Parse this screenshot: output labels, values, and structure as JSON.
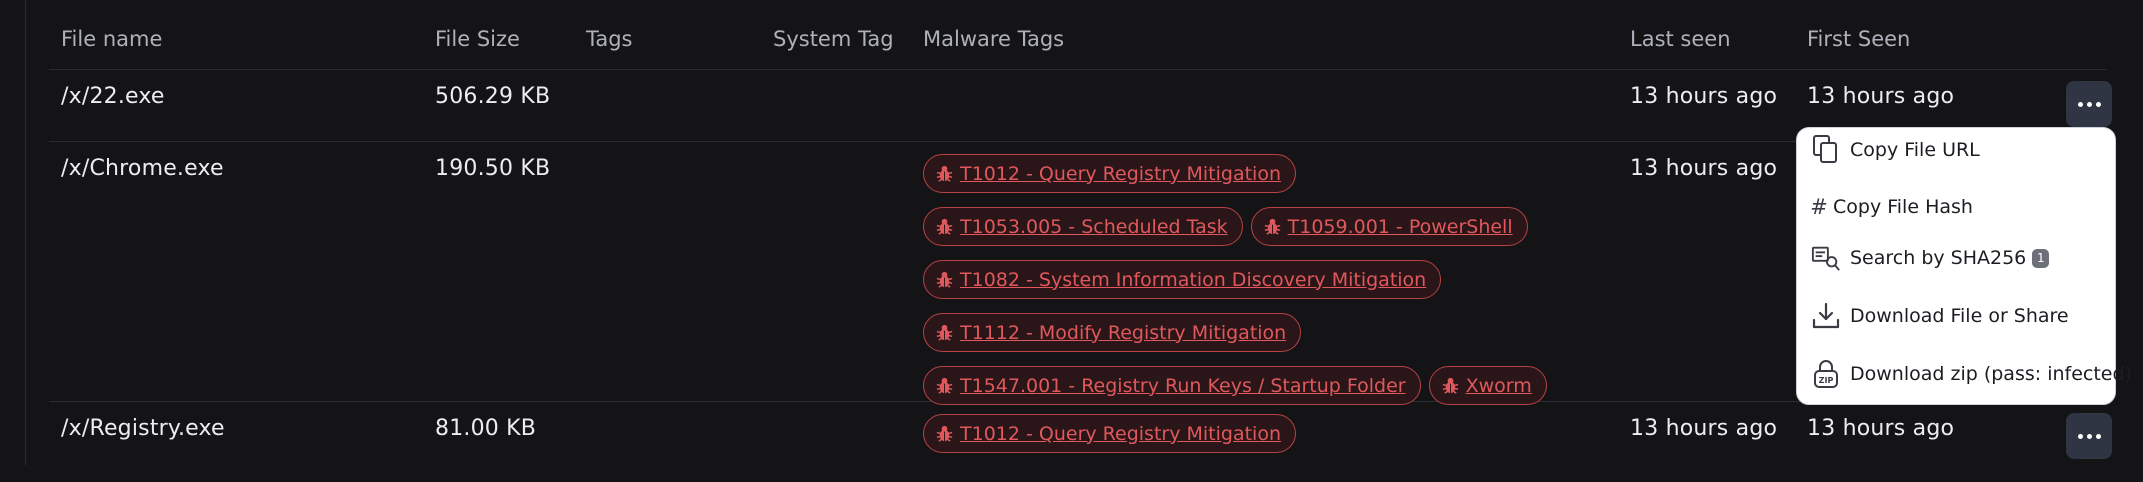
{
  "columns": [
    "File name",
    "File Size",
    "Tags",
    "System Tag",
    "Malware Tags",
    "Last seen",
    "First Seen"
  ],
  "rows": [
    {
      "name": "/x/22.exe",
      "size": "506.29 KB",
      "last_seen": "13 hours ago",
      "first_seen": "13 hours ago",
      "malware_tags": []
    },
    {
      "name": "/x/Chrome.exe",
      "size": "190.50 KB",
      "last_seen": "13 hours ago",
      "first_seen": "",
      "malware_tags": [
        "T1012 - Query Registry Mitigation",
        "T1053.005 - Scheduled Task",
        "T1059.001 - PowerShell",
        "T1082 - System Information Discovery Mitigation",
        "T1112 - Modify Registry Mitigation",
        "T1547.001 - Registry Run Keys / Startup Folder",
        "Xworm"
      ]
    },
    {
      "name": "/x/Registry.exe",
      "size": "81.00 KB",
      "last_seen": "13 hours ago",
      "first_seen": "13 hours ago",
      "malware_tags": [
        "T1012 - Query Registry Mitigation"
      ]
    }
  ],
  "menu": {
    "items": [
      {
        "label": "Copy File URL",
        "icon": "copy-icon"
      },
      {
        "label": "Copy File Hash",
        "icon": "hash-icon"
      },
      {
        "label": "Search by SHA256",
        "icon": "search-hash-icon",
        "badge": "1"
      },
      {
        "label": "Download File or Share",
        "icon": "download-icon"
      },
      {
        "label": "Download zip (pass: infected)",
        "icon": "zip-lock-icon"
      }
    ]
  },
  "colors": {
    "background": "#141417",
    "tag_text": "#e0585c",
    "tag_border": "#b54245",
    "button_bg": "#2f3543"
  }
}
